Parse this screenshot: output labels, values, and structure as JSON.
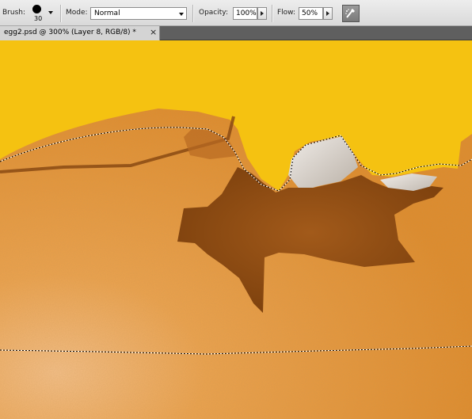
{
  "options_bar": {
    "brush_label": "Brush:",
    "brush_size": "30",
    "mode_label": "Mode:",
    "mode_value": "Normal",
    "opacity_label": "Opacity:",
    "opacity_value": "100%",
    "flow_label": "Flow:",
    "flow_value": "50%",
    "airbrush_icon": "airbrush-icon"
  },
  "document_tab": {
    "title": "egg2.psd @ 300% (Layer 8, RGB/8) *",
    "close_glyph": "×"
  },
  "canvas": {
    "background_color": "#f5c211",
    "shell_color": "#e08a27",
    "hole_color": "#8f4b12",
    "membrane_color": "#dcd6d0"
  }
}
